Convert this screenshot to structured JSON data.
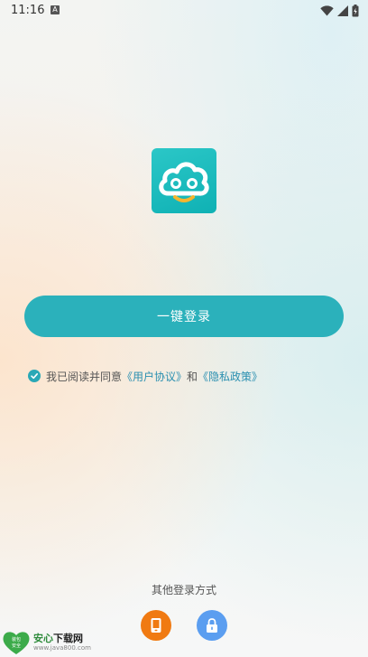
{
  "status_bar": {
    "time": "11:16",
    "notification_letter": "A"
  },
  "login": {
    "one_click_label": "一键登录"
  },
  "agreement": {
    "prefix": "我已阅读并同意",
    "user_agreement": "《用户协议》",
    "conjunction": "和",
    "privacy_policy": "《隐私政策》"
  },
  "other_login": {
    "title": "其他登录方式",
    "methods": [
      {
        "icon": "phone-icon",
        "color": "#f07a12"
      },
      {
        "icon": "lock-icon",
        "color": "#5b9ef0"
      }
    ]
  },
  "watermark": {
    "badge_top": "装包",
    "badge_bottom": "安全",
    "title_main": "安心",
    "title_suffix": "下载网",
    "url": "www.java800.com"
  },
  "colors": {
    "accent": "#2bb1bb",
    "link": "#2a8fb0",
    "logo": "#15b6b8"
  }
}
